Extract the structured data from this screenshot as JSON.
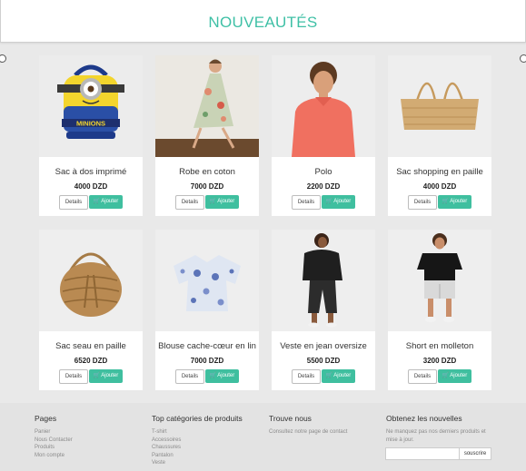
{
  "header": {
    "title": "NOUVEAUTÉS"
  },
  "buttons": {
    "details": "Details",
    "add": "Ajouter"
  },
  "products": [
    {
      "name": "Sac à dos imprimé",
      "price": "4000 DZD",
      "image": "minion-backpack"
    },
    {
      "name": "Robe en coton",
      "price": "7000 DZD",
      "image": "floral-dress-woman"
    },
    {
      "name": "Polo",
      "price": "2200 DZD",
      "image": "boy-coral-polo"
    },
    {
      "name": "Sac shopping en paille",
      "price": "4000 DZD",
      "image": "straw-tote-bag"
    },
    {
      "name": "Sac seau en paille",
      "price": "6520 DZD",
      "image": "straw-bucket-bag"
    },
    {
      "name": "Blouse cache-cœur en lin",
      "price": "7000 DZD",
      "image": "blue-print-blouse"
    },
    {
      "name": "Veste en jean oversize",
      "price": "5500 DZD",
      "image": "woman-black-jacket"
    },
    {
      "name": "Short en molleton",
      "price": "3200 DZD",
      "image": "boy-sweat-shorts"
    }
  ],
  "footer": {
    "pages": {
      "title": "Pages",
      "links": [
        "Panier",
        "Nous Contacter",
        "Produits",
        "Mon compte"
      ]
    },
    "categories": {
      "title": "Top catégories de produits",
      "links": [
        "T-shirt",
        "Accessoires",
        "Chaussures",
        "Pantalon",
        "Veste"
      ]
    },
    "contact": {
      "title": "Trouve nous",
      "text": "Consultez notre page de contact"
    },
    "newsletter": {
      "title": "Obtenez les nouvelles",
      "text": "Ne manquez pas nos derniers produits et mise à jour.",
      "placeholder": "",
      "button": "souscrire"
    }
  },
  "colors": {
    "accent": "#3fbf9f",
    "title": "#3fc0a6"
  },
  "icons": {
    "cart": "cart-icon"
  }
}
